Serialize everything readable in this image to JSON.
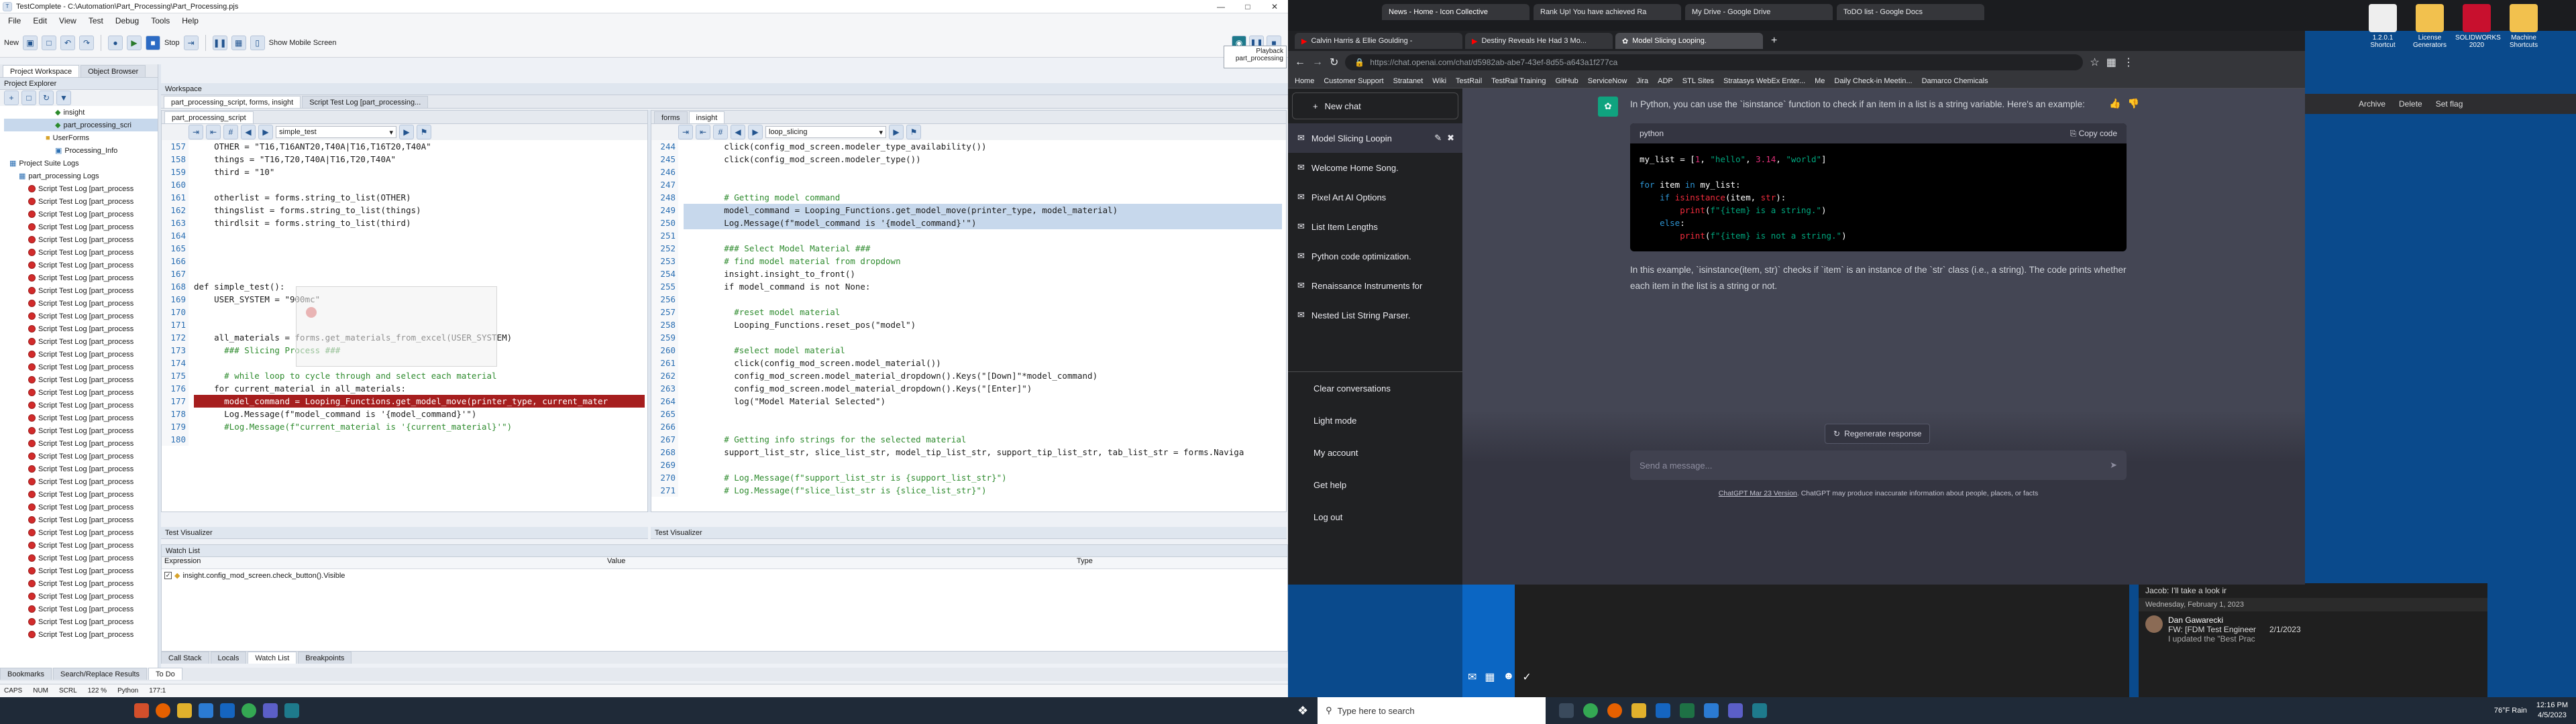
{
  "ide": {
    "title": "TestComplete - C:\\Automation\\Part_Processing\\Part_Processing.pjs",
    "menu": [
      "File",
      "Edit",
      "View",
      "Test",
      "Debug",
      "Tools",
      "Help"
    ],
    "toolbar": {
      "new": "New",
      "stop": "Stop",
      "show_mobile": "Show Mobile Screen",
      "playback": "Playback",
      "playback_target": "part_processing"
    },
    "left_tabs": [
      "Project Workspace",
      "Object Browser"
    ],
    "explorer_title": "Project Explorer",
    "tree": [
      "insight",
      "part_processing_scri",
      "UserForms",
      "Processing_Info",
      "Project Suite Logs",
      "part_processing Logs"
    ],
    "log_item": "Script Test Log [part_process",
    "workspace_title": "Workspace",
    "editor_tabs": [
      "part_processing_script, forms, insight",
      "Script Test Log [part_processing..."
    ],
    "left_editor": {
      "tab": "part_processing_script",
      "routine": "simple_test",
      "line_numbers": [
        "157",
        "158",
        "159",
        "160",
        "161",
        "162",
        "163",
        "164",
        "165",
        "166",
        "167",
        "168",
        "169",
        "170",
        "171",
        "172",
        "173",
        "174",
        "175",
        "176",
        "177",
        "178",
        "179",
        "180"
      ],
      "lines": [
        "    OTHER = \"T16,T16ANT20,T40A|T16,T16T20,T40A\"",
        "    things = \"T16,T20,T40A|T16,T20,T40A\"",
        "    third = \"10\"",
        "",
        "    otherlist = forms.string_to_list(OTHER)",
        "    thingslist = forms.string_to_list(things)",
        "    thirdlsit = forms.string_to_list(third)",
        "",
        "",
        "",
        "",
        "def simple_test():",
        "    USER_SYSTEM = \"900mc\"",
        "",
        "",
        "    all_materials = forms.get_materials_from_excel(USER_SYSTEM)",
        "      ### Slicing Process ###",
        "",
        "      # while loop to cycle through and select each material",
        "    for current_material in all_materials:",
        "      model_command = Looping_Functions.get_model_move(printer_type, current_mater",
        "      Log.Message(f\"model_command is '{model_command}'\")",
        "      #Log.Message(f\"current_material is '{current_material}'\")",
        ""
      ]
    },
    "right_editor": {
      "tabs": [
        "forms",
        "insight"
      ],
      "routine": "loop_slicing",
      "line_numbers": [
        "244",
        "245",
        "246",
        "247",
        "248",
        "249",
        "250",
        "251",
        "252",
        "253",
        "254",
        "255",
        "256",
        "257",
        "258",
        "259",
        "260",
        "261",
        "262",
        "263",
        "264",
        "265",
        "266",
        "267",
        "268",
        "269",
        "270",
        "271"
      ],
      "lines": [
        "        click(config_mod_screen.modeler_type_availability())",
        "        click(config_mod_screen.modeler_type())",
        "",
        "",
        "        # Getting model command",
        "        model_command = Looping_Functions.get_model_move(printer_type, model_material)",
        "        Log.Message(f\"model_command is '{model_command}'\")",
        "",
        "        ### Select Model Material ###",
        "        # find model material from dropdown",
        "        insight.insight_to_front()",
        "        if model_command is not None:",
        "",
        "          #reset model material",
        "          Looping_Functions.reset_pos(\"model\")",
        "",
        "          #select model material",
        "          click(config_mod_screen.model_material())",
        "          config_mod_screen.model_material_dropdown().Keys(\"[Down]\"*model_command)",
        "          config_mod_screen.model_material_dropdown().Keys(\"[Enter]\")",
        "          log(\"Model Material Selected\")",
        "",
        "",
        "        # Getting info strings for the selected material",
        "        support_list_str, slice_list_str, model_tip_list_str, support_tip_list_str, tab_list_str = forms.Naviga",
        "",
        "        # Log.Message(f\"support_list_str is {support_list_str}\")",
        "        # Log.Message(f\"slice_list_str is {slice_list_str}\")"
      ]
    },
    "visualizer_left": "Test Visualizer",
    "visualizer_right": "Test Visualizer",
    "watch_title": "Watch List",
    "watch_headers": [
      "Expression",
      "Value",
      "Type"
    ],
    "watch_row": "insight.config_mod_screen.check_button().Visible",
    "bottom_tabs": [
      "Call Stack",
      "Locals",
      "Watch List",
      "Breakpoints"
    ],
    "bottom_tabs2": [
      "Bookmarks",
      "Search/Replace Results",
      "To Do"
    ],
    "status": {
      "caps": "CAPS",
      "num": "NUM",
      "scrl": "SCRL",
      "zoom": "122 %",
      "lang": "Python",
      "position": "177:1"
    }
  },
  "browser": {
    "tabs": [
      "Calvin Harris & Ellie Goulding -",
      "Destiny Reveals He Had 3 Mo...",
      "Model Slicing Looping."
    ],
    "url": "https://chat.openai.com/chat/d5982ab-abe7-43ef-8d55-a643a1f277ca",
    "bookmarks": [
      "Home",
      "Customer Support",
      "Stratanet",
      "Wiki",
      "TestRail",
      "TestRail Training",
      "GitHub",
      "ServiceNow",
      "Jira",
      "ADP",
      "STL Sites",
      "Stratasys WebEx Enter...",
      "Me",
      "Daily Check-in Meetin...",
      "Damarco Chemicals"
    ]
  },
  "gpt": {
    "new_chat": "New chat",
    "conversations": [
      "Model Slicing Loopin",
      "Welcome Home Song.",
      "Pixel Art AI Options",
      "List Item Lengths",
      "Python code optimization.",
      "Renaissance Instruments for",
      "Nested List String Parser."
    ],
    "bottom_menu": [
      "Clear conversations",
      "Light mode",
      "My account",
      "Get help",
      "Log out"
    ],
    "answer_intro": "In Python, you can use the `isinstance` function to check if an item in a list is a string variable. Here's an example:",
    "code_lang": "python",
    "copy_code": "Copy code",
    "code_lines": [
      "my_list = [1, \"hello\", 3.14, \"world\"]",
      "",
      "for item in my_list:",
      "    if isinstance(item, str):",
      "        print(f\"{item} is a string.\")",
      "    else:",
      "        print(f\"{item} is not a string.\")"
    ],
    "answer_outro": "In this example, `isinstance(item, str)` checks if `item` is an instance of the `str` class (i.e., a string). The code prints whether each item in the list is a string or not.",
    "regenerate": "Regenerate response",
    "input_placeholder": "Send a message...",
    "footer_link": "ChatGPT Mar 23 Version",
    "footer": ". ChatGPT may produce inaccurate information about people, places, or facts"
  },
  "top_browser": {
    "tabs": [
      "News - Home - Icon Collective",
      "Rank Up! You have achieved Ra",
      "My Drive - Google Drive",
      "ToDO list - Google Docs"
    ]
  },
  "desktop": {
    "icons": [
      "1.2.0.1 Shortcut",
      "License Generators",
      "SOLIDWORKS 2020",
      "Machine Shortcuts"
    ],
    "side_menu": [
      "Archive",
      "Delete",
      "Set flag"
    ]
  },
  "outlook": {
    "date_header": "Wednesday, February 1, 2023",
    "preview1_line": "Jacob: I'll take a look ir",
    "sender": "Dan Gawarecki",
    "subject": "FW: [FDM Test Engineer",
    "date": "2/1/2023",
    "preview": "I updated the \"Best Prac"
  },
  "taskbar": {
    "search": "Type here to search",
    "weather": "76°F  Rain",
    "time": "12:16 PM",
    "date": "4/5/2023"
  },
  "colors": {
    "ide_bg": "#eef1f6",
    "gpt_side": "#202123",
    "gpt_main": "#444654",
    "highlight": "#c7d8ec",
    "error_line": "#a61e1e"
  }
}
